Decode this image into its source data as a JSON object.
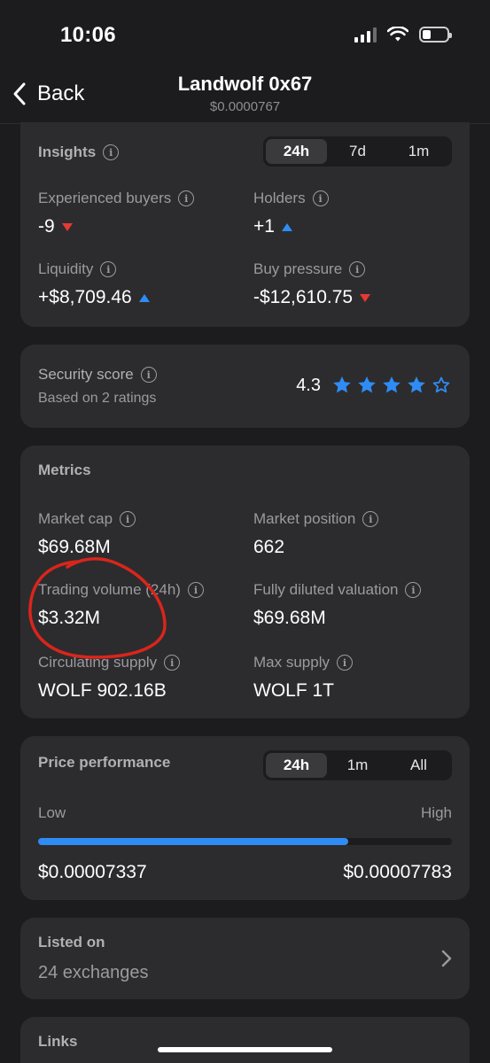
{
  "status": {
    "time": "10:06"
  },
  "nav": {
    "back_label": "Back",
    "title": "Landwolf 0x67",
    "subtitle": "$0.0000767"
  },
  "insights": {
    "title": "Insights",
    "tabs": [
      "24h",
      "7d",
      "1m"
    ],
    "active_tab": "24h",
    "items": [
      {
        "label": "Experienced buyers",
        "value": "-9",
        "trend": "down"
      },
      {
        "label": "Holders",
        "value": "+1",
        "trend": "up"
      },
      {
        "label": "Liquidity",
        "value": "+$8,709.46",
        "trend": "up"
      },
      {
        "label": "Buy pressure",
        "value": "-$12,610.75",
        "trend": "down"
      }
    ]
  },
  "security": {
    "title": "Security score",
    "subtitle": "Based on 2 ratings",
    "score": "4.3",
    "stars_filled": 4,
    "stars_total": 5
  },
  "metrics": {
    "title": "Metrics",
    "items": [
      {
        "label": "Market cap",
        "value": "$69.68M"
      },
      {
        "label": "Market position",
        "value": "662"
      },
      {
        "label": "Trading volume (24h)",
        "value": "$3.32M"
      },
      {
        "label": "Fully diluted valuation",
        "value": "$69.68M"
      },
      {
        "label": "Circulating supply",
        "value": "WOLF 902.16B"
      },
      {
        "label": "Max supply",
        "value": "WOLF 1T"
      }
    ]
  },
  "price_performance": {
    "title": "Price performance",
    "tabs": [
      "24h",
      "1m",
      "All"
    ],
    "active_tab": "24h",
    "low_label": "Low",
    "high_label": "High",
    "low_value": "$0.00007337",
    "high_value": "$0.00007783",
    "current_fraction": 0.75
  },
  "listed": {
    "title": "Listed on",
    "value": "24 exchanges"
  },
  "links": {
    "title": "Links"
  },
  "colors": {
    "accent": "#2f8cf5",
    "down": "#e53935",
    "annotation": "#d9251c"
  }
}
